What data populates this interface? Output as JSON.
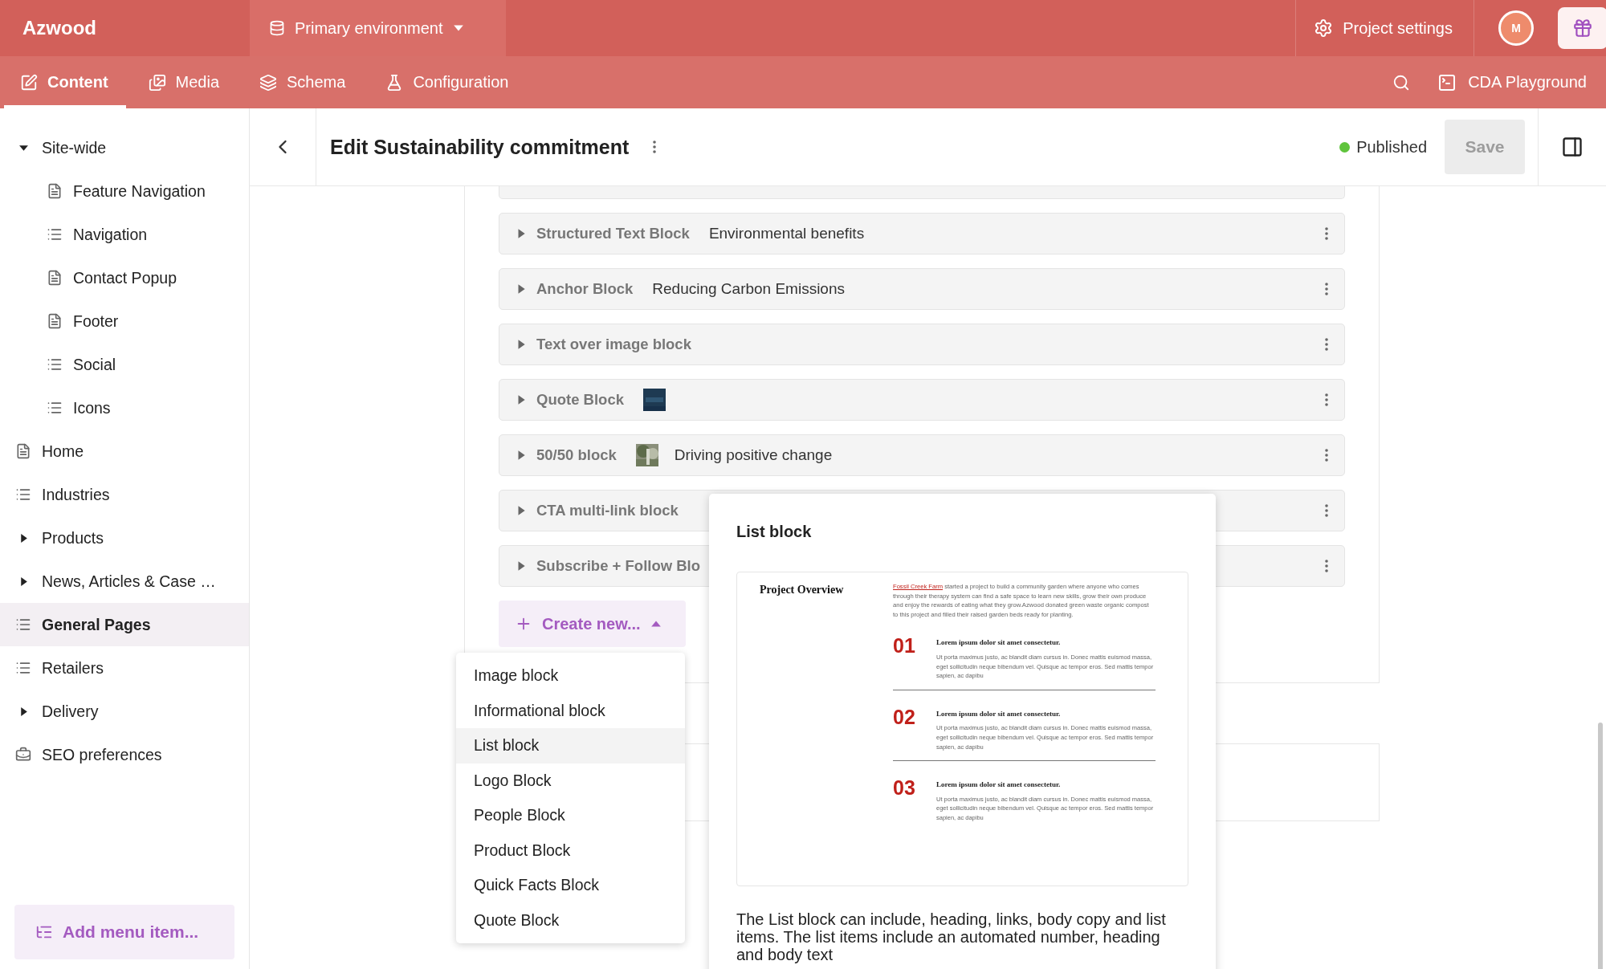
{
  "brand": "Azwood",
  "environment": {
    "label": "Primary environment"
  },
  "project_settings": {
    "label": "Project settings"
  },
  "avatar": {
    "initial": "M"
  },
  "nav_tabs": [
    {
      "label": "Content",
      "selected": true
    },
    {
      "label": "Media",
      "selected": false
    },
    {
      "label": "Schema",
      "selected": false
    },
    {
      "label": "Configuration",
      "selected": false
    }
  ],
  "cda_playground": {
    "label": "CDA Playground"
  },
  "sidebar": {
    "items": [
      {
        "label": "Site-wide",
        "kind": "folder",
        "expanded": true,
        "selected": false,
        "children": [
          {
            "label": "Feature Navigation",
            "kind": "record",
            "selected": false
          },
          {
            "label": "Navigation",
            "kind": "collection",
            "selected": false
          },
          {
            "label": "Contact Popup",
            "kind": "record",
            "selected": false
          },
          {
            "label": "Footer",
            "kind": "record",
            "selected": false
          },
          {
            "label": "Social",
            "kind": "collection",
            "selected": false
          },
          {
            "label": "Icons",
            "kind": "collection",
            "selected": false
          }
        ]
      },
      {
        "label": "Home",
        "kind": "record",
        "selected": false
      },
      {
        "label": "Industries",
        "kind": "collection",
        "selected": false
      },
      {
        "label": "Products",
        "kind": "folder",
        "expanded": false,
        "selected": false
      },
      {
        "label": "News, Articles & Case …",
        "kind": "folder",
        "expanded": false,
        "selected": false
      },
      {
        "label": "General Pages",
        "kind": "collection",
        "selected": true
      },
      {
        "label": "Retailers",
        "kind": "collection",
        "selected": false
      },
      {
        "label": "Delivery",
        "kind": "folder",
        "expanded": false,
        "selected": false
      },
      {
        "label": "SEO preferences",
        "kind": "settings",
        "selected": false
      }
    ],
    "add_button": "Add menu item..."
  },
  "editor": {
    "title": "Edit Sustainability commitment",
    "status": {
      "label": "Published",
      "color": "#5fc43c"
    },
    "save": {
      "label": "Save",
      "disabled": true
    }
  },
  "blocks": [
    {
      "type": "Structured Text Block",
      "summary": "Environmental benefits"
    },
    {
      "type": "Anchor Block",
      "summary": "Reducing Carbon Emissions"
    },
    {
      "type": "Text over image block"
    },
    {
      "type": "Quote Block",
      "thumbnail": true
    },
    {
      "type": "50/50 block",
      "summary": "Driving positive change",
      "thumbnail": true
    },
    {
      "type": "CTA multi-link block"
    },
    {
      "type": "Subscribe + Follow Blo"
    }
  ],
  "create_new": {
    "label": "Create new...",
    "expanded": true
  },
  "block_menu": [
    {
      "label": "Image block",
      "selected": false
    },
    {
      "label": "Informational block",
      "selected": false
    },
    {
      "label": "List block",
      "selected": true
    },
    {
      "label": "Logo Block",
      "selected": false
    },
    {
      "label": "People Block",
      "selected": false
    },
    {
      "label": "Product Block",
      "selected": false
    },
    {
      "label": "Quick Facts Block",
      "selected": false
    },
    {
      "label": "Quote Block",
      "selected": false
    }
  ],
  "preview": {
    "title": "List block",
    "sample": {
      "heading": "Project Overview",
      "intro_link": "Fossil Creek Farm",
      "intro": "started a project to build a community garden where anyone who comes through their therapy system can find a safe space to learn new skills, grow their own produce and enjoy the rewards of eating what they grow.Azwood donated green waste organic compost to this project and filled their raised garden beds ready for planting.",
      "items": [
        {
          "number": "01",
          "heading": "Lorem ipsum dolor sit amet consectetur.",
          "body": "Ut porta maximus justo, ac blandit diam cursus in. Donec mattis euismod massa, eget sollicitudin neque bibendum vel. Quisque ac tempor eros. Sed mattis tempor sapien, ac dapibu"
        },
        {
          "number": "02",
          "heading": "Lorem ipsum dolor sit amet consectetur.",
          "body": "Ut porta maximus justo, ac blandit diam cursus in. Donec mattis euismod massa, eget sollicitudin neque bibendum vel. Quisque ac tempor eros. Sed mattis tempor sapien, ac dapibu"
        },
        {
          "number": "03",
          "heading": "Lorem ipsum dolor sit amet consectetur.",
          "body": "Ut porta maximus justo, ac blandit diam cursus in. Donec mattis euismod massa, eget sollicitudin neque bibendum vel. Quisque ac tempor eros. Sed mattis tempor sapien, ac dapibu"
        }
      ]
    },
    "description": "The List block can include, heading, links, body copy and list items. The list items include an automated number, heading and body text"
  }
}
